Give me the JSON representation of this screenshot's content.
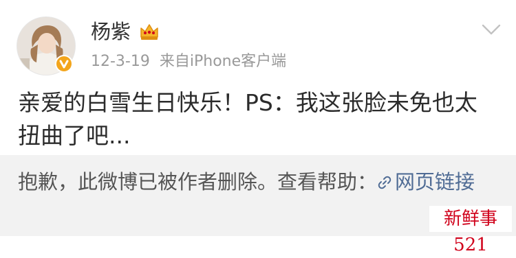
{
  "post": {
    "username": "杨紫",
    "date": "12-3-19",
    "source": "来自iPhone客户端",
    "content": "亲爱的白雪生日快乐！PS：我这张脸未免也太扭曲了吧...",
    "icons": {
      "avatar": "avatar-image",
      "vip": "vip-verified-icon",
      "crown": "crown-icon",
      "menu": "chevron-down-icon"
    }
  },
  "deleted_notice": {
    "text": "抱歉，此微博已被作者删除。查看帮助：",
    "link_label": "网页链接",
    "link_icon": "link-icon"
  },
  "watermark": {
    "text": "新鲜事521"
  },
  "colors": {
    "username": "#333333",
    "meta": "#999999",
    "content": "#2b2b2b",
    "notice_bg": "#f2f2f2",
    "link": "#506c95",
    "watermark": "#d0021b",
    "badge": "#f3a51c"
  }
}
